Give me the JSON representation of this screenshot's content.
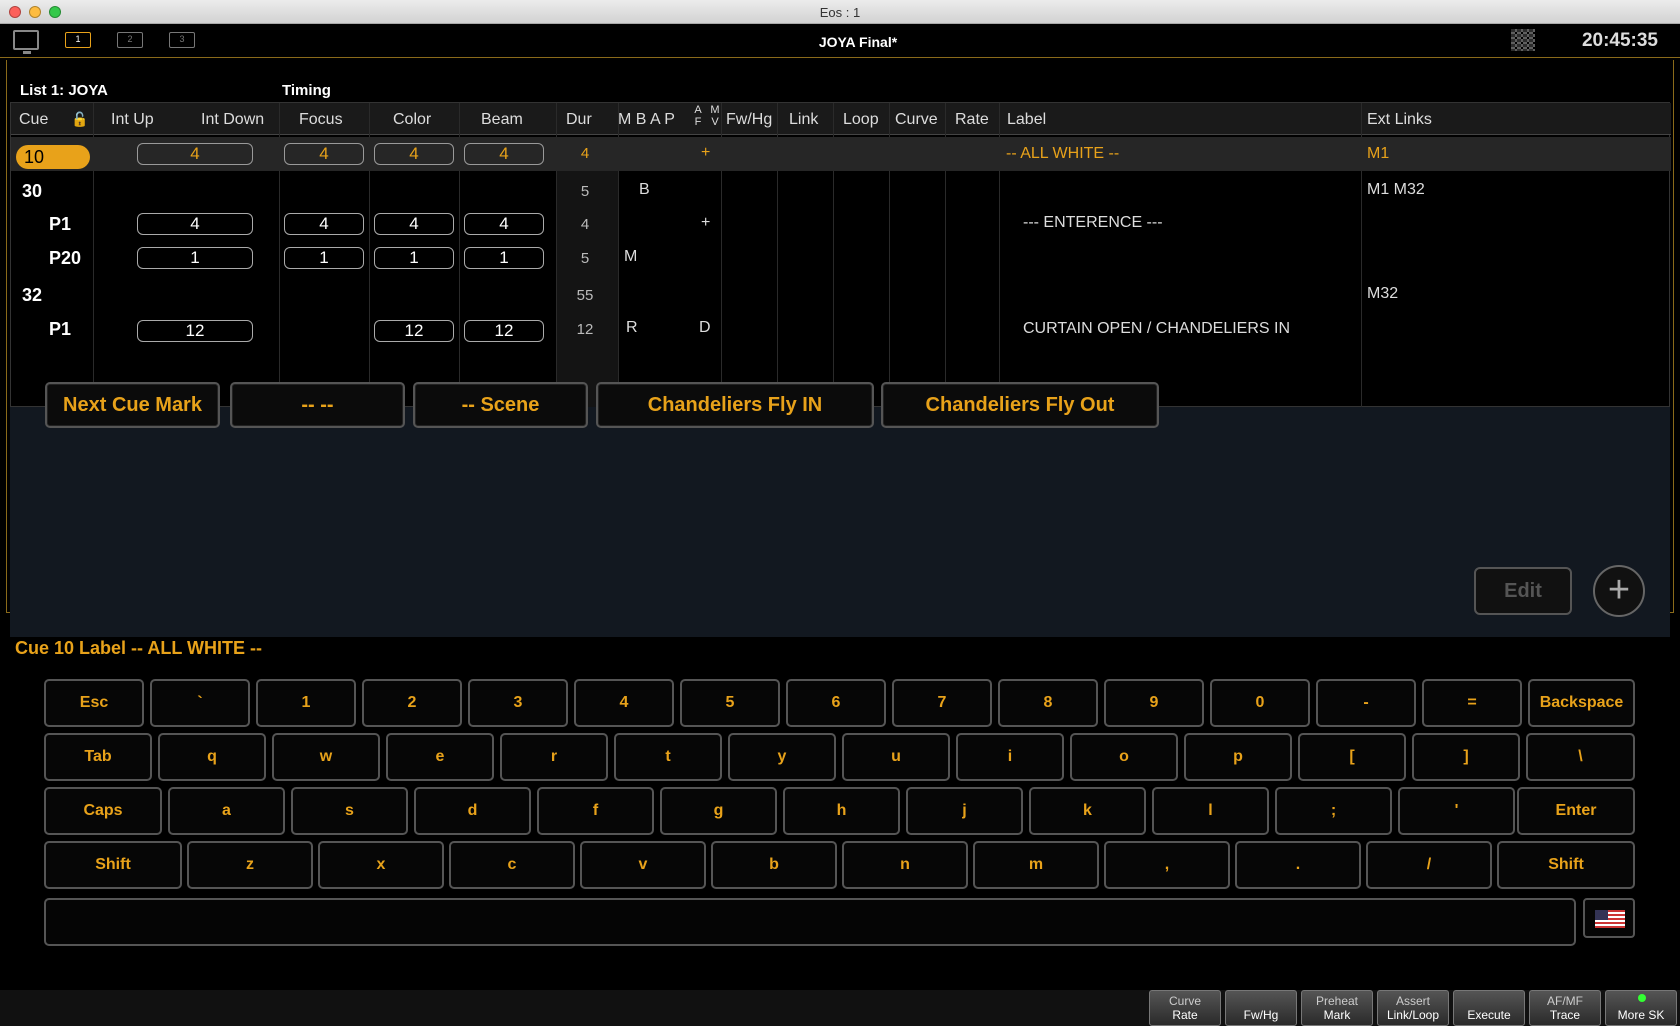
{
  "window": {
    "title": "Eos : 1"
  },
  "topbar": {
    "tabs": [
      "1",
      "2",
      "3"
    ],
    "show_name": "JOYA Final*",
    "clock": "20:45:35"
  },
  "list": {
    "title": "List 1: JOYA",
    "timing_label": "Timing"
  },
  "columns": {
    "cue": "Cue",
    "int_up": "Int Up",
    "int_down": "Int Down",
    "focus": "Focus",
    "color": "Color",
    "beam": "Beam",
    "dur": "Dur",
    "mbap": "M B A P",
    "af": "A F",
    "mv": "M V",
    "fwhg": "Fw/Hg",
    "link": "Link",
    "loop": "Loop",
    "curve": "Curve",
    "rate": "Rate",
    "label": "Label",
    "ext_links": "Ext Links"
  },
  "rows": [
    {
      "cue": "10",
      "int_up": "4",
      "int_down": "",
      "focus": "4",
      "color": "4",
      "beam": "4",
      "dur": "4",
      "mbap": "",
      "af": "+",
      "label": "-- ALL WHITE --",
      "ext": "M1"
    },
    {
      "cue": "30",
      "int_up": "",
      "int_down": "",
      "focus": "",
      "color": "",
      "beam": "",
      "dur": "5",
      "mbap": "B",
      "af": "",
      "label": "",
      "ext": "M1 M32"
    },
    {
      "cue": "P1",
      "int_up": "4",
      "int_down": "",
      "focus": "4",
      "color": "4",
      "beam": "4",
      "dur": "4",
      "mbap": "",
      "af": "+",
      "label": "--- ENTERENCE ---",
      "ext": ""
    },
    {
      "cue": "P20",
      "int_up": "1",
      "int_down": "",
      "focus": "1",
      "color": "1",
      "beam": "1",
      "dur": "5",
      "mbap": "M",
      "af": "",
      "label": "",
      "ext": ""
    },
    {
      "cue": "32",
      "int_up": "",
      "int_down": "",
      "focus": "",
      "color": "",
      "beam": "",
      "dur": "55",
      "mbap": "",
      "af": "",
      "label": "",
      "ext": "M32"
    },
    {
      "cue": "P1",
      "int_up": "12",
      "int_down": "",
      "focus": "",
      "color": "12",
      "beam": "12",
      "dur": "12",
      "mbap": "R",
      "af": "D",
      "label": "CURTAIN OPEN / CHANDELIERS IN",
      "ext": ""
    }
  ],
  "macros": [
    "Next Cue Mark",
    "-- --",
    "-- Scene",
    "Chandeliers Fly IN",
    "Chandeliers Fly Out"
  ],
  "edit_label": "Edit",
  "plus_label": "+",
  "command_line": "Cue 10 Label -- ALL WHITE --",
  "keyboard": {
    "row1": [
      "Esc",
      "`",
      "1",
      "2",
      "3",
      "4",
      "5",
      "6",
      "7",
      "8",
      "9",
      "0",
      "-",
      "=",
      "Backspace"
    ],
    "row2": [
      "Tab",
      "q",
      "w",
      "e",
      "r",
      "t",
      "y",
      "u",
      "i",
      "o",
      "p",
      "[",
      "]",
      "\\"
    ],
    "row3": [
      "Caps",
      "a",
      "s",
      "d",
      "f",
      "g",
      "h",
      "j",
      "k",
      "l",
      ";",
      "'",
      "Enter"
    ],
    "row4": [
      "Shift",
      "z",
      "x",
      "c",
      "v",
      "b",
      "n",
      "m",
      ",",
      ".",
      "/",
      "Shift"
    ]
  },
  "softkeys": [
    {
      "top": "Curve",
      "bottom": "Rate"
    },
    {
      "top": "",
      "bottom": "Fw/Hg"
    },
    {
      "top": "Preheat",
      "bottom": "Mark"
    },
    {
      "top": "Assert",
      "bottom": "Link/Loop"
    },
    {
      "top": "",
      "bottom": "Execute"
    },
    {
      "top": "AF/MF",
      "bottom": "Trace"
    },
    {
      "top": "",
      "bottom": "More SK"
    }
  ]
}
